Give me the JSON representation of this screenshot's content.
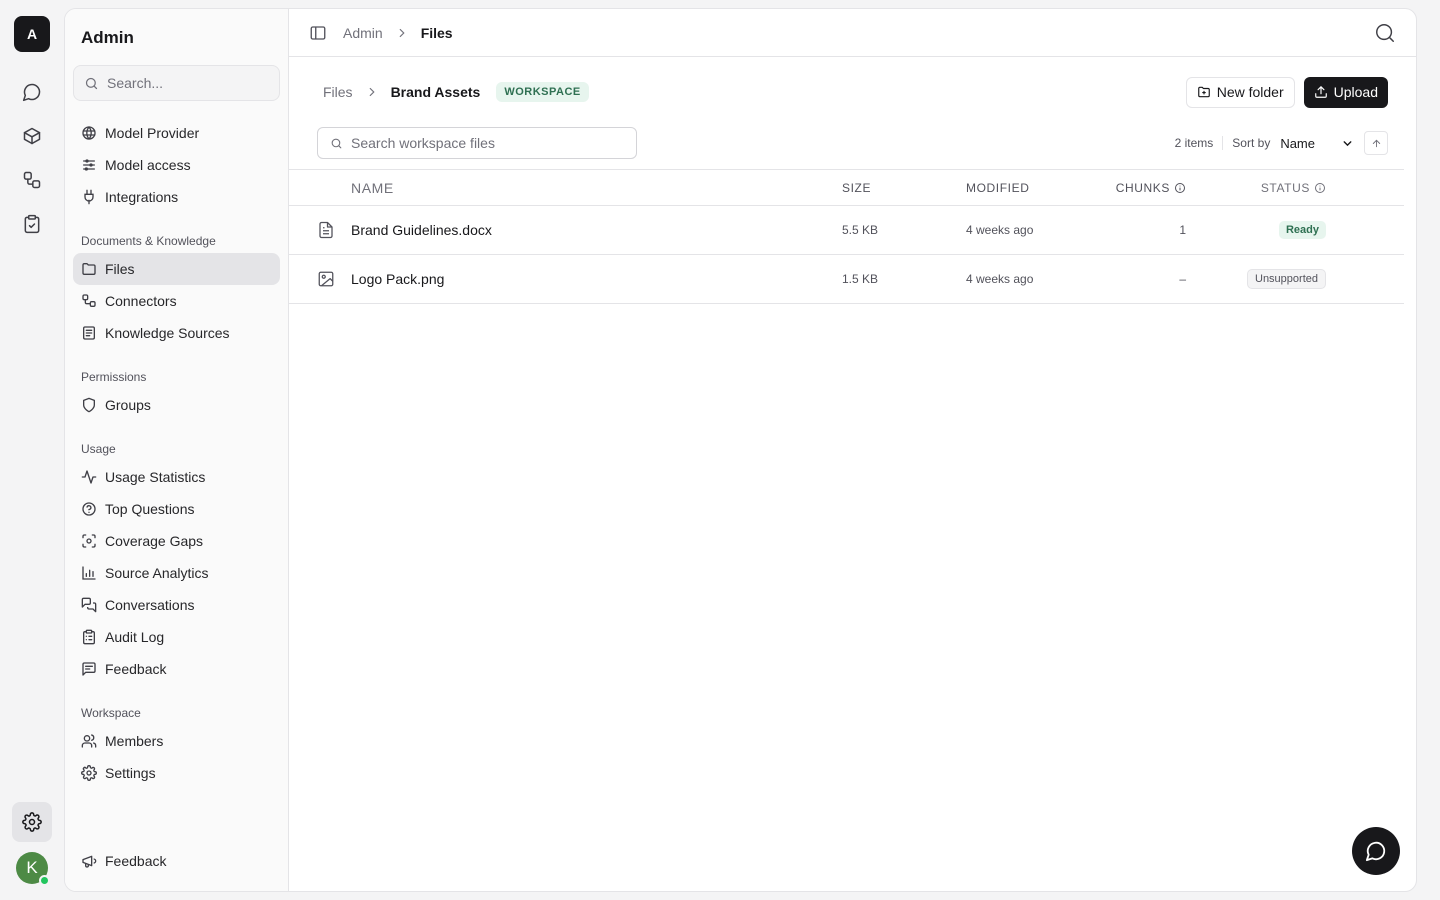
{
  "rail": {
    "logo_letter": "A",
    "avatar_letter": "K"
  },
  "sidebar": {
    "title": "Admin",
    "search_placeholder": "Search...",
    "top_items": [
      {
        "label": "Model Provider",
        "icon": "globe-icon"
      },
      {
        "label": "Model access",
        "icon": "sliders-icon"
      },
      {
        "label": "Integrations",
        "icon": "plug-icon"
      }
    ],
    "sections": [
      {
        "label": "Documents & Knowledge",
        "items": [
          {
            "label": "Files",
            "icon": "folder-icon",
            "active": true
          },
          {
            "label": "Connectors",
            "icon": "workflow-icon"
          },
          {
            "label": "Knowledge Sources",
            "icon": "book-icon"
          }
        ]
      },
      {
        "label": "Permissions",
        "items": [
          {
            "label": "Groups",
            "icon": "shield-icon"
          }
        ]
      },
      {
        "label": "Usage",
        "items": [
          {
            "label": "Usage Statistics",
            "icon": "activity-icon"
          },
          {
            "label": "Top Questions",
            "icon": "help-circle-icon"
          },
          {
            "label": "Coverage Gaps",
            "icon": "scan-icon"
          },
          {
            "label": "Source Analytics",
            "icon": "bar-chart-icon"
          },
          {
            "label": "Conversations",
            "icon": "messages-icon"
          },
          {
            "label": "Audit Log",
            "icon": "clipboard-list-icon"
          },
          {
            "label": "Feedback",
            "icon": "message-square-text-icon"
          }
        ]
      },
      {
        "label": "Workspace",
        "items": [
          {
            "label": "Members",
            "icon": "users-icon"
          },
          {
            "label": "Settings",
            "icon": "gear-icon"
          }
        ]
      }
    ],
    "footer_label": "Feedback"
  },
  "topbar": {
    "crumb_parent": "Admin",
    "crumb_current": "Files"
  },
  "header": {
    "crumb_parent": "Files",
    "crumb_current": "Brand Assets",
    "badge": "WORKSPACE",
    "new_folder_label": "New folder",
    "upload_label": "Upload"
  },
  "filters": {
    "search_placeholder": "Search workspace files",
    "item_count": "2 items",
    "sort_label": "Sort by",
    "sort_value": "Name"
  },
  "table": {
    "columns": {
      "name": "NAME",
      "size": "SIZE",
      "modified": "MODIFIED",
      "chunks": "CHUNKS",
      "status": "STATUS"
    },
    "rows": [
      {
        "icon": "file-text-icon",
        "name": "Brand Guidelines.docx",
        "size": "5.5 KB",
        "modified": "4 weeks ago",
        "chunks": "1",
        "status": "Ready"
      },
      {
        "icon": "image-icon",
        "name": "Logo Pack.png",
        "size": "1.5 KB",
        "modified": "4 weeks ago",
        "chunks": "–",
        "status": "Unsupported"
      }
    ]
  },
  "colors": {
    "accent_dark": "#18181b",
    "badge_green_bg": "#e7f5ee",
    "badge_green_text": "#2f7052",
    "avatar_green": "#4d8a45"
  }
}
